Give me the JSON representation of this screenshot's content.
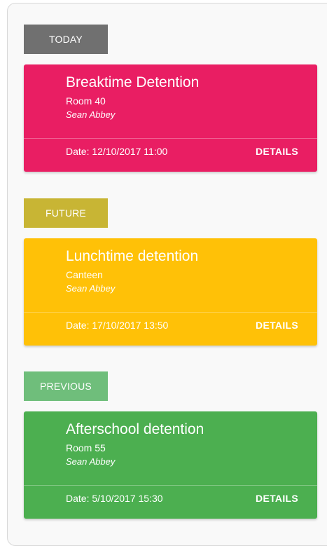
{
  "colors": {
    "today": "#e91e63",
    "future": "#ffc107",
    "previous": "#4caf50",
    "today_label": "#707070",
    "future_label": "#c8b534",
    "previous_label": "#6fbe7b"
  },
  "sections": {
    "today": {
      "label": "TODAY",
      "card": {
        "title": "Breaktime Detention",
        "room": "Room 40",
        "teacher": "Sean Abbey",
        "date": "Date: 12/10/2017 11:00",
        "details": "DETAILS"
      }
    },
    "future": {
      "label": "FUTURE",
      "card": {
        "title": "Lunchtime detention",
        "room": "Canteen",
        "teacher": "Sean Abbey",
        "date": "Date: 17/10/2017 13:50",
        "details": "DETAILS"
      }
    },
    "previous": {
      "label": "PREVIOUS",
      "card": {
        "title": "Afterschool detention",
        "room": "Room 55",
        "teacher": "Sean Abbey",
        "date": "Date: 5/10/2017 15:30",
        "details": "DETAILS"
      }
    }
  }
}
